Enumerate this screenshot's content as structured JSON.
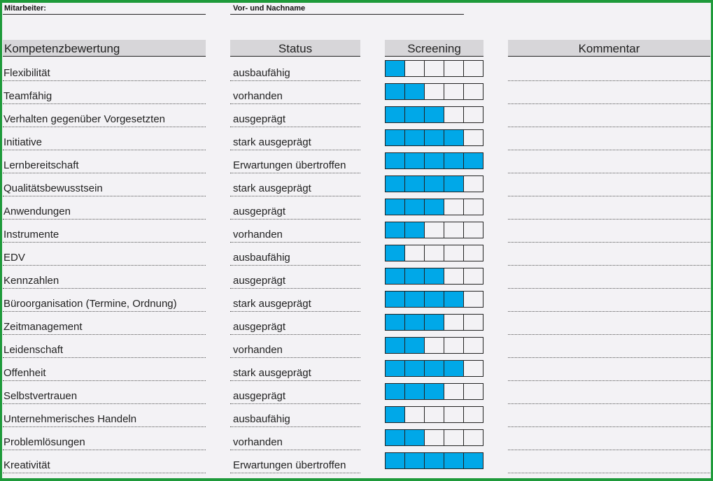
{
  "header": {
    "employee_label": "Mitarbeiter:",
    "name_label": "Vor- und Nachname"
  },
  "columns": {
    "competence": "Kompetenzbewertung",
    "status": "Status",
    "screening": "Screening",
    "comment": "Kommentar"
  },
  "screening_max": 5,
  "colors": {
    "filled": "#00a8e8",
    "border_frame": "#1e9a3a"
  },
  "rows": [
    {
      "competence": "Flexibilität",
      "status": "ausbaufähig",
      "score": 1,
      "comment": ""
    },
    {
      "competence": "Teamfähig",
      "status": "vorhanden",
      "score": 2,
      "comment": ""
    },
    {
      "competence": "Verhalten gegenüber Vorgesetzten",
      "status": "ausgeprägt",
      "score": 3,
      "comment": ""
    },
    {
      "competence": "Initiative",
      "status": "stark ausgeprägt",
      "score": 4,
      "comment": ""
    },
    {
      "competence": "Lernbereitschaft",
      "status": "Erwartungen übertroffen",
      "score": 5,
      "comment": ""
    },
    {
      "competence": "Qualitätsbewusstsein",
      "status": "stark ausgeprägt",
      "score": 4,
      "comment": ""
    },
    {
      "competence": "Anwendungen",
      "status": "ausgeprägt",
      "score": 3,
      "comment": ""
    },
    {
      "competence": "Instrumente",
      "status": "vorhanden",
      "score": 2,
      "comment": ""
    },
    {
      "competence": "EDV",
      "status": "ausbaufähig",
      "score": 1,
      "comment": ""
    },
    {
      "competence": "Kennzahlen",
      "status": "ausgeprägt",
      "score": 3,
      "comment": ""
    },
    {
      "competence": "Büroorganisation (Termine, Ordnung)",
      "status": "stark ausgeprägt",
      "score": 4,
      "comment": ""
    },
    {
      "competence": "Zeitmanagement",
      "status": "ausgeprägt",
      "score": 3,
      "comment": ""
    },
    {
      "competence": "Leidenschaft",
      "status": "vorhanden",
      "score": 2,
      "comment": ""
    },
    {
      "competence": "Offenheit",
      "status": "stark ausgeprägt",
      "score": 4,
      "comment": ""
    },
    {
      "competence": "Selbstvertrauen",
      "status": "ausgeprägt",
      "score": 3,
      "comment": ""
    },
    {
      "competence": "Unternehmerisches Handeln",
      "status": "ausbaufähig",
      "score": 1,
      "comment": ""
    },
    {
      "competence": "Problemlösungen",
      "status": "vorhanden",
      "score": 2,
      "comment": ""
    },
    {
      "competence": "Kreativität",
      "status": "Erwartungen übertroffen",
      "score": 5,
      "comment": ""
    }
  ]
}
